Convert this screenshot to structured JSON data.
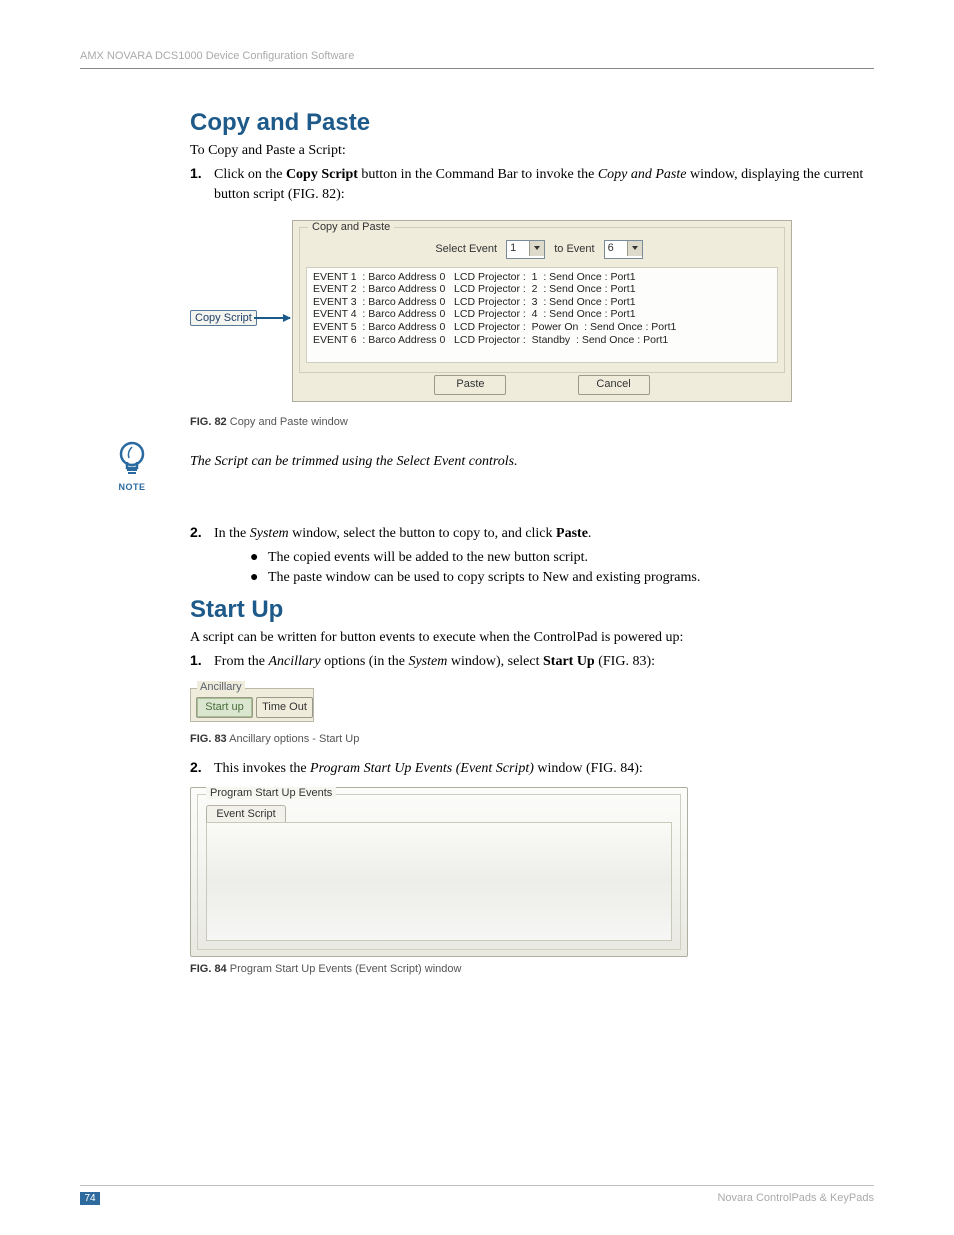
{
  "header": "AMX NOVARA DCS1000 Device Configuration Software",
  "section1": {
    "title": "Copy and Paste",
    "intro": "To Copy and Paste a Script:",
    "step1_pre": "Click on the ",
    "step1_b1": "Copy Script",
    "step1_mid": " button in the Command Bar to invoke the ",
    "step1_i1": "Copy and Paste",
    "step1_post": " window, displaying the current button script (FIG. 82):"
  },
  "fig82": {
    "copy_script_label": "Copy Script",
    "group_label": "Copy and Paste",
    "select_event_label": "Select Event",
    "from_value": "1",
    "to_label": "to Event",
    "to_value": "6",
    "events": [
      "EVENT 1  : Barco Address 0   LCD Projector :  1  : Send Once : Port1",
      "EVENT 2  : Barco Address 0   LCD Projector :  2  : Send Once : Port1",
      "EVENT 3  : Barco Address 0   LCD Projector :  3  : Send Once : Port1",
      "EVENT 4  : Barco Address 0   LCD Projector :  4  : Send Once : Port1",
      "EVENT 5  : Barco Address 0   LCD Projector :  Power On  : Send Once : Port1",
      "EVENT 6  : Barco Address 0   LCD Projector :  Standby  : Send Once : Port1"
    ],
    "paste_label": "Paste",
    "cancel_label": "Cancel",
    "caption_b": "FIG. 82",
    "caption_t": " Copy and Paste window"
  },
  "note": {
    "label": "NOTE",
    "text": "The Script can be trimmed using the Select Event controls."
  },
  "section1b": {
    "step2_pre": "In the ",
    "step2_i1": "System",
    "step2_mid": " window, select the button to copy to, and click ",
    "step2_b1": "Paste",
    "step2_post": ".",
    "bullet1": "The copied events will be added to the new button script.",
    "bullet2": "The paste window can be used to copy scripts to New and existing programs."
  },
  "section2": {
    "title": "Start Up",
    "intro": "A script can be written for button events to execute when the ControlPad is powered up:",
    "step1_pre": "From the ",
    "step1_i1": "Ancillary",
    "step1_mid": " options (in the ",
    "step1_i2": "System",
    "step1_mid2": " window), select ",
    "step1_b1": "Start Up",
    "step1_post": " (FIG. 83):"
  },
  "fig83": {
    "group_label": "Ancillary",
    "startup_label": "Start up",
    "timeout_label": "Time Out",
    "caption_b": "FIG. 83",
    "caption_t": " Ancillary options - Start Up"
  },
  "section2b": {
    "step2_pre": "This invokes the ",
    "step2_i1": "Program Start Up Events (Event Script)",
    "step2_post": " window (FIG. 84):"
  },
  "fig84": {
    "group_label": "Program Start Up Events",
    "tab_label": "Event Script",
    "caption_b": "FIG. 84",
    "caption_t": " Program Start Up Events (Event Script) window"
  },
  "footer": {
    "page_number": "74",
    "product": "Novara ControlPads & KeyPads"
  }
}
